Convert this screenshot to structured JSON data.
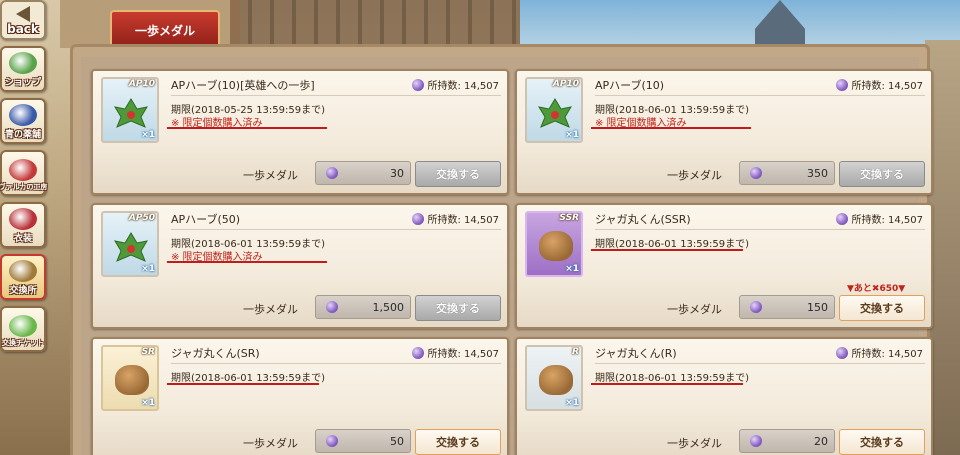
{
  "sidebar": {
    "back_label": "back",
    "items": [
      {
        "label": "ショップ",
        "icon": "shop-icon",
        "color": "#5aa34a"
      },
      {
        "label": "青の薬舗",
        "icon": "blue-shop-character-icon",
        "color": "#3a5aa8"
      },
      {
        "label": "ヴァルカの工房",
        "icon": "vulcan-workshop-character-icon",
        "color": "#c43a3a"
      },
      {
        "label": "衣装",
        "icon": "costume-icon",
        "color": "#b8323a"
      },
      {
        "label": "交換所",
        "icon": "exchange-pot-icon",
        "color": "#a07a3a"
      },
      {
        "label": "交換チケット",
        "icon": "exchange-ticket-icon",
        "color": "#6ab84a"
      }
    ]
  },
  "tab": {
    "label": "一歩メダル"
  },
  "currency_label": "一歩メダル",
  "owned_label": "所持数: 14,507",
  "cards": [
    {
      "name": "APハーブ(10)[英雄への一歩]",
      "tag": "AP10",
      "qty": "×1",
      "type": "herb",
      "deadline": "期限(2018-05-25 13:59:59まで)",
      "limited": "※ 限定個数購入済み",
      "cost": "30",
      "button": "交換する",
      "enabled": false,
      "remain": ""
    },
    {
      "name": "APハーブ(10)",
      "tag": "AP10",
      "qty": "×1",
      "type": "herb",
      "deadline": "期限(2018-06-01 13:59:59まで)",
      "limited": "※ 限定個数購入済み",
      "cost": "350",
      "button": "交換する",
      "enabled": false,
      "remain": ""
    },
    {
      "name": "APハーブ(50)",
      "tag": "AP50",
      "qty": "×1",
      "type": "herb",
      "deadline": "期限(2018-06-01 13:59:59まで)",
      "limited": "※ 限定個数購入済み",
      "cost": "1,500",
      "button": "交換する",
      "enabled": false,
      "remain": ""
    },
    {
      "name": "ジャガ丸くん(SSR)",
      "tag": "SSR",
      "qty": "×1",
      "type": "ssr",
      "deadline": "期限(2018-06-01 13:59:59まで)",
      "limited": "",
      "cost": "150",
      "button": "交換する",
      "enabled": true,
      "remain": "▼あと✖650▼"
    },
    {
      "name": "ジャガ丸くん(SR)",
      "tag": "SR",
      "qty": "×1",
      "type": "sr",
      "deadline": "期限(2018-06-01 13:59:59まで)",
      "limited": "",
      "cost": "50",
      "button": "交換する",
      "enabled": true,
      "remain": ""
    },
    {
      "name": "ジャガ丸くん(R)",
      "tag": "R",
      "qty": "×1",
      "type": "r",
      "deadline": "期限(2018-06-01 13:59:59まで)",
      "limited": "",
      "cost": "20",
      "button": "交換する",
      "enabled": true,
      "remain": ""
    }
  ]
}
